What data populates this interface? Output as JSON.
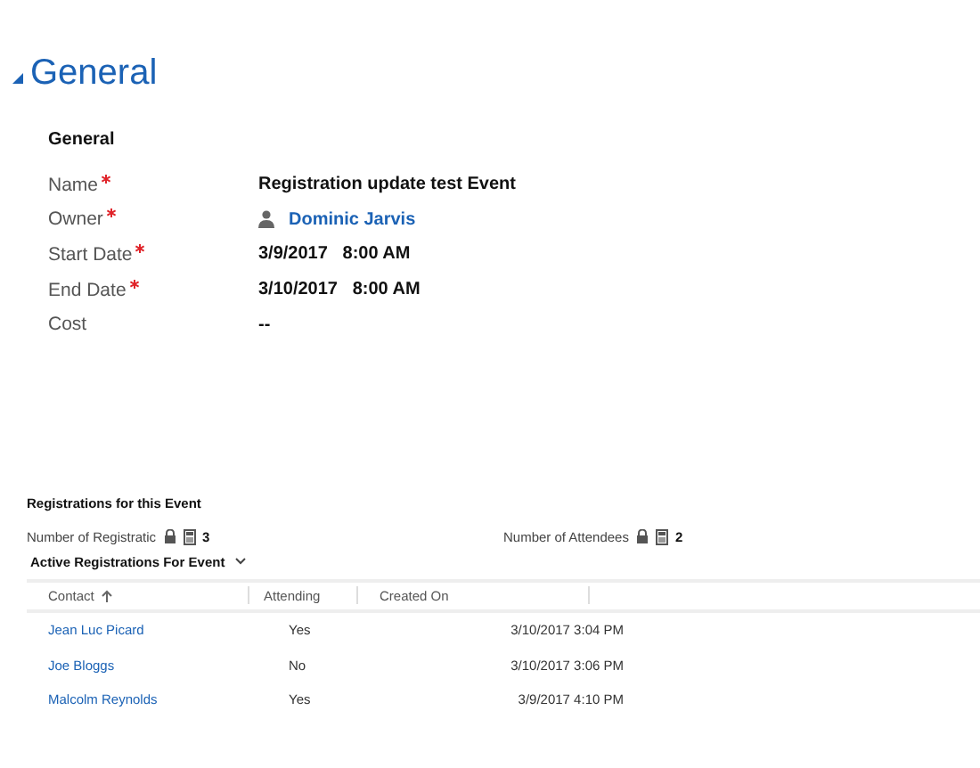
{
  "section": {
    "title": "General",
    "expanded": true
  },
  "group": {
    "title": "General",
    "fields": [
      {
        "label": "Name",
        "required": true,
        "kind": "text",
        "value": "Registration update test Event"
      },
      {
        "label": "Owner",
        "required": true,
        "kind": "user",
        "value": "Dominic Jarvis"
      },
      {
        "label": "Start Date",
        "required": true,
        "kind": "text",
        "value": "3/9/2017   8:00 AM"
      },
      {
        "label": "End Date",
        "required": true,
        "kind": "text",
        "value": "3/10/2017   8:00 AM"
      },
      {
        "label": "Cost",
        "required": false,
        "kind": "text",
        "value": "--"
      }
    ]
  },
  "registrations": {
    "title": "Registrations for this Event",
    "rollups": [
      {
        "label": "Number of Registratic",
        "value": "3"
      },
      {
        "label": "Number of Attendees",
        "value": "2"
      }
    ],
    "view_title": "Active Registrations For Event",
    "columns": [
      {
        "label": "Contact",
        "sorted": true
      },
      {
        "label": "Attending",
        "sorted": false
      },
      {
        "label": "Created On",
        "sorted": false
      }
    ],
    "rows": [
      {
        "contact": "Jean Luc Picard",
        "attending": "Yes",
        "created_on": "3/10/2017 3:04 PM"
      },
      {
        "contact": "Joe Bloggs",
        "attending": "No",
        "created_on": "3/10/2017 3:06 PM"
      },
      {
        "contact": "Malcolm Reynolds",
        "attending": "Yes",
        "created_on": "3/9/2017 4:10 PM"
      }
    ]
  }
}
